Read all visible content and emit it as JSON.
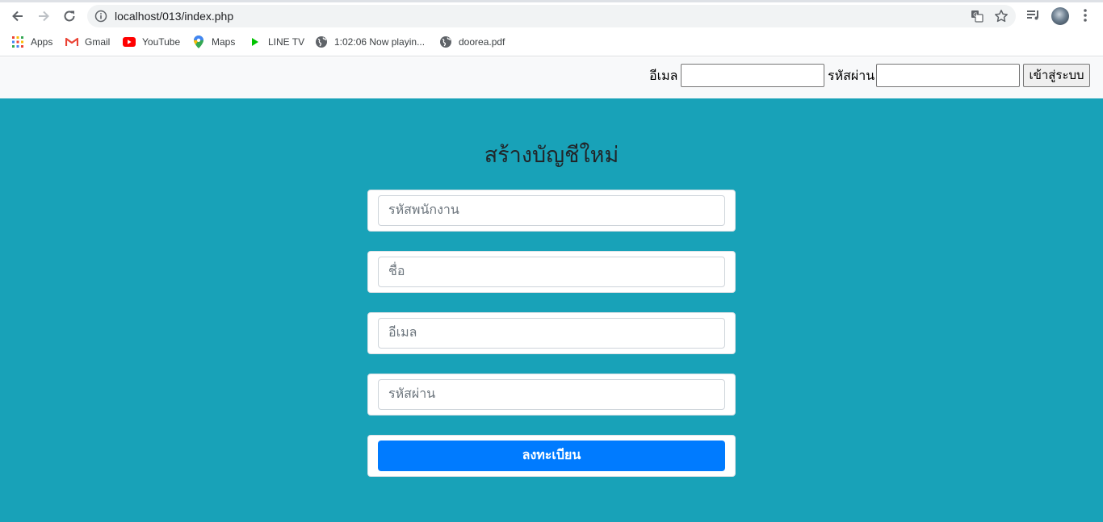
{
  "browser": {
    "url": "localhost/013/index.php",
    "bookmarks": [
      {
        "label": "Apps",
        "icon": "apps-grid-icon"
      },
      {
        "label": "Gmail",
        "icon": "gmail-icon"
      },
      {
        "label": "YouTube",
        "icon": "youtube-icon"
      },
      {
        "label": "Maps",
        "icon": "maps-pin-icon"
      },
      {
        "label": "LINE TV",
        "icon": "play-icon"
      },
      {
        "label": "1:02:06 Now playin...",
        "icon": "globe-icon"
      },
      {
        "label": "doorea.pdf",
        "icon": "globe-icon"
      }
    ]
  },
  "navbar": {
    "email_label": "อีเมล",
    "password_label": "รหัสผ่าน",
    "login_button": "เข้าสู่ระบบ"
  },
  "register": {
    "title": "สร้างบัญชีใหม่",
    "fields": [
      {
        "placeholder": "รหัสพนักงาน"
      },
      {
        "placeholder": "ชื่อ"
      },
      {
        "placeholder": "อีเมล"
      },
      {
        "placeholder": "รหัสผ่าน"
      }
    ],
    "submit_label": "ลงทะเบียน"
  },
  "colors": {
    "hero_background": "#18a2b8",
    "primary_button": "#007bff",
    "navbar_background": "#f8f9fa"
  }
}
